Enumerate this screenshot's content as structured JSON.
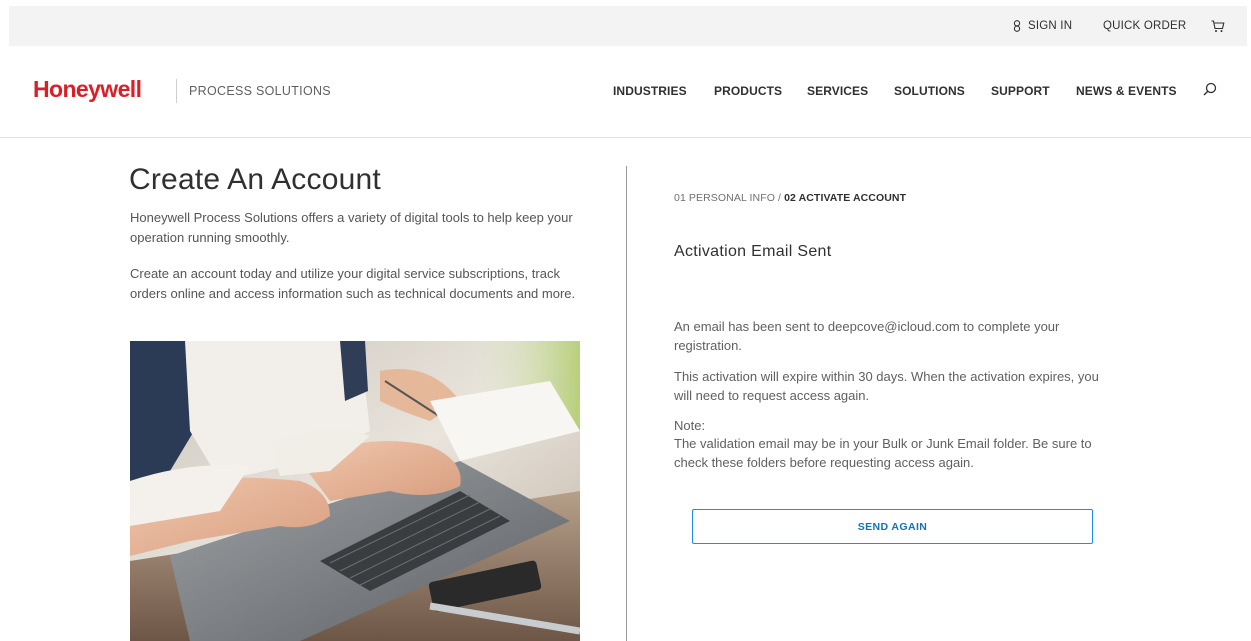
{
  "utility": {
    "sign_in": "SIGN IN",
    "quick_order": "QUICK ORDER"
  },
  "header": {
    "logo": "Honeywell",
    "logo_sub": "PROCESS SOLUTIONS",
    "nav": [
      "INDUSTRIES",
      "PRODUCTS",
      "SERVICES",
      "SOLUTIONS",
      "SUPPORT",
      "NEWS & EVENTS"
    ]
  },
  "left": {
    "title": "Create An Account",
    "intro_1": "Honeywell Process Solutions offers a variety of digital tools to help keep your operation running smoothly.",
    "intro_2": "Create an account today and utilize your digital service subscriptions, track orders online and access information such as technical documents and more."
  },
  "right": {
    "step_1": "01 PERSONAL INFO /",
    "step_2": "02 ACTIVATE ACCOUNT",
    "title": "Activation Email Sent",
    "msg_1": "An email has been sent to deepcove@icloud.com to complete your registration.",
    "msg_2": "This activation will expire within 30 days. When the activation expires, you will need to request access again.",
    "note_label": "Note:",
    "note_text": "The validation email may be in your Bulk or Junk Email folder. Be sure to check these folders before requesting access again.",
    "send_again": "SEND AGAIN"
  },
  "colors": {
    "brand_red": "#dc1e28",
    "accent_blue": "#1792e5"
  },
  "icons": [
    "user-icon",
    "cart-icon",
    "search-icon",
    "photo-laptop-hands"
  ]
}
